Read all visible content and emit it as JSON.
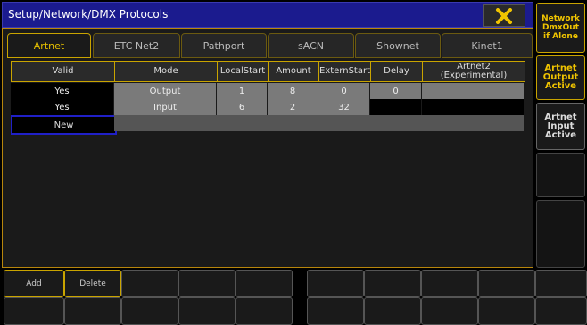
{
  "window": {
    "title": "Setup/Network/DMX Protocols"
  },
  "tabs": [
    {
      "label": "Artnet",
      "active": true
    },
    {
      "label": "ETC Net2"
    },
    {
      "label": "Pathport"
    },
    {
      "label": "sACN"
    },
    {
      "label": "Shownet"
    },
    {
      "label": "Kinet1"
    }
  ],
  "table": {
    "headers": [
      "Valid",
      "Mode",
      "LocalStart",
      "Amount",
      "ExternStart",
      "Delay",
      "Artnet2\n(Experimental)"
    ],
    "rows": [
      [
        "Yes",
        "Output",
        "1",
        "8",
        "0",
        "0",
        ""
      ],
      [
        "Yes",
        "Input",
        "6",
        "2",
        "32",
        "",
        ""
      ]
    ],
    "new_row_label": "New"
  },
  "bottom_buttons": {
    "add": "Add",
    "delete": "Delete"
  },
  "side_buttons": [
    {
      "label": "Network\nDmxOut\nif Alone"
    },
    {
      "label": "Artnet\nOutput\nActive"
    },
    {
      "label": "Artnet\nInput\nActive"
    }
  ],
  "colors": {
    "accent": "#c9a400",
    "title_bar": "#1b1b8e"
  },
  "icons": {
    "close": "close-x-icon"
  }
}
